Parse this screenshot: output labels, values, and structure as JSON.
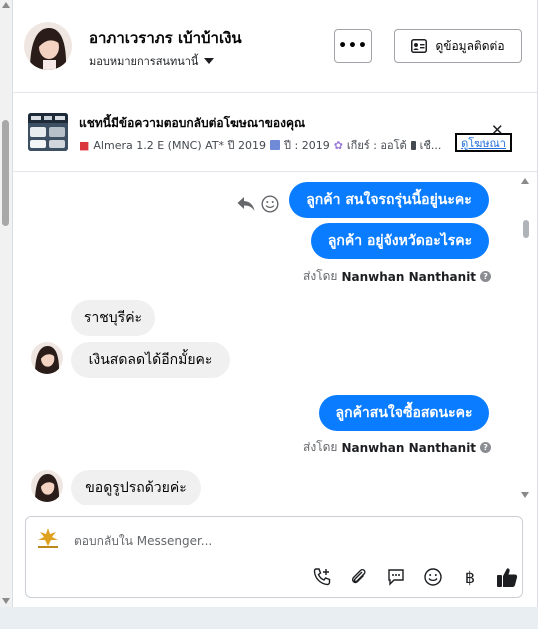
{
  "header": {
    "name": "อาภาเวราภร เบ้าบ้าเงิน",
    "assign_label": "มอบหมายการสนทนานี้",
    "more_label": "•••",
    "contact_label": "ดูข้อมูลติดต่อ"
  },
  "ad": {
    "title": "แชทนี้มีข้อความตอบกลับต่อโฆษณาของคุณ",
    "car": "Almera 1.2 E (MNC) AT* ปี 2019",
    "year": "ปี : 2019",
    "gear": "เกียร์ : ออโต้",
    "fuel": "เชื...",
    "link_label": "ดูโฆษณา"
  },
  "messages": {
    "out1": "ลูกค้า  สนใจรถรุ่นนี้อยู่นะคะ",
    "out2": "ลูกค้า อยู่จังหวัดอะไรคะ",
    "sent_prefix": "ส่งโดย",
    "sender": "Nanwhan Nanthanit",
    "in1": "ราชบุรีค่ะ",
    "in2": "เงินสดลดได้อีกมั้ยคะ",
    "out3": "ลูกค้าสนใจซื้อสดนะคะ",
    "in3": "ขอดูรูปรถด้วยค่ะ"
  },
  "composer": {
    "placeholder": "ตอบกลับใน Messenger..."
  },
  "colors": {
    "accent": "#0a7cff",
    "incoming": "#f0f0f0",
    "link": "#216fdb"
  },
  "icons": [
    "chevron-down-icon",
    "contact-card-icon",
    "close-icon",
    "car-icon",
    "calendar-icon",
    "gear-icon",
    "fuel-icon",
    "reply-icon",
    "emoji-icon",
    "help-icon",
    "call-icon",
    "attach-icon",
    "saved-reply-icon",
    "baht-icon",
    "thumbs-up-icon"
  ]
}
